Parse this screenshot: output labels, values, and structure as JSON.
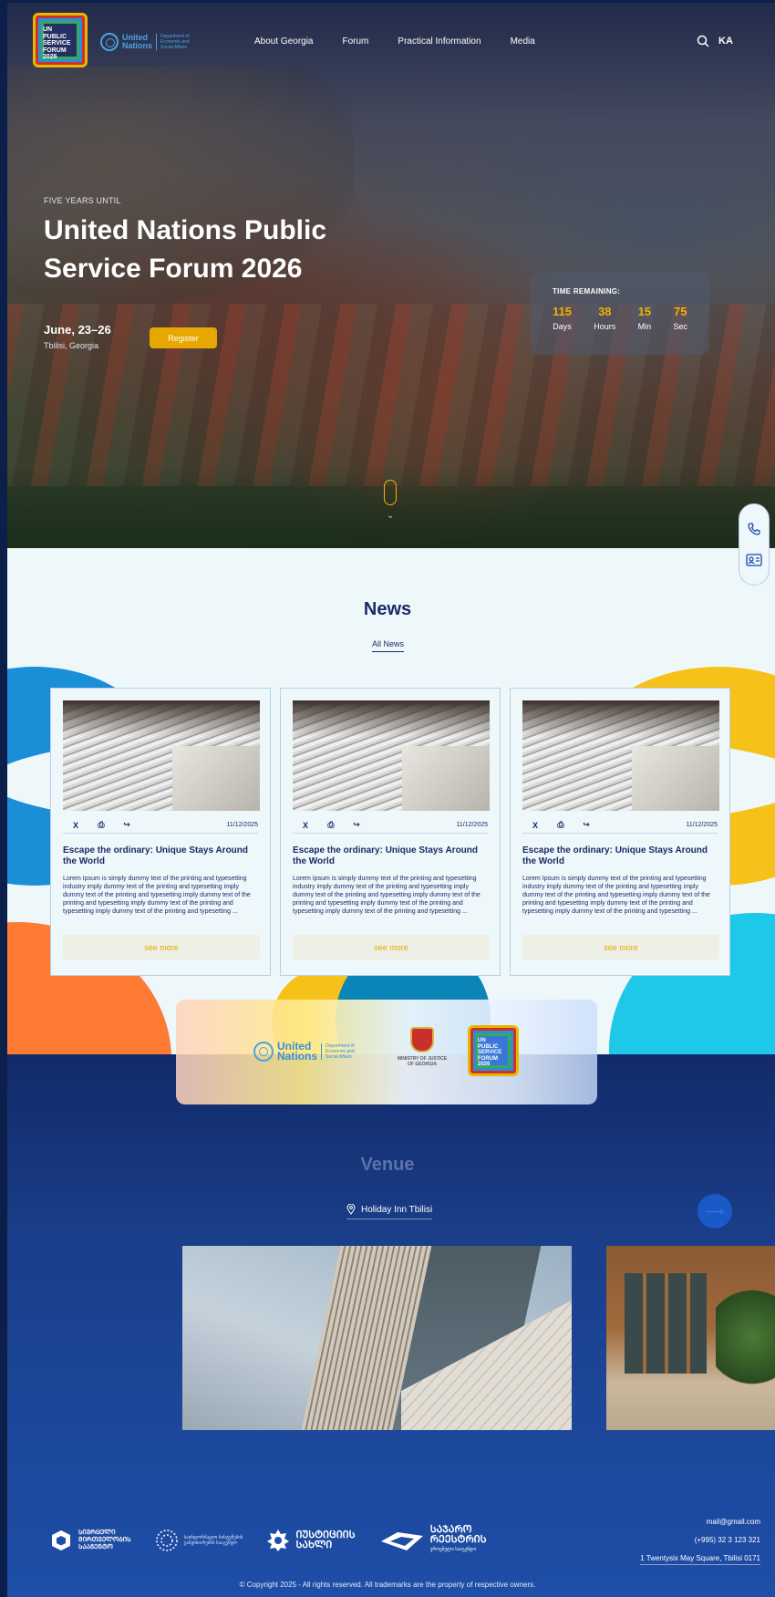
{
  "header": {
    "logo_lines": [
      "UN",
      "PUBLIC",
      "SERVICE",
      "FORUM",
      "2026"
    ],
    "un_name_lines": [
      "United",
      "Nations"
    ],
    "un_dept_lines": [
      "Department of",
      "Economic and",
      "Social Affairs"
    ],
    "nav": [
      "About Georgia",
      "Forum",
      "Practical Information",
      "Media"
    ],
    "lang": "KA"
  },
  "hero": {
    "eyebrow": "FIVE YEARS UNTIL",
    "title": "United Nations Public Service Forum 2026",
    "date": "June, 23–26",
    "city": "Tbilisi, Georgia",
    "register_label": "Register",
    "countdown": {
      "label": "TIME REMAINING:",
      "items": [
        {
          "value": "115",
          "unit": "Days"
        },
        {
          "value": "38",
          "unit": "Hours"
        },
        {
          "value": "15",
          "unit": "Min"
        },
        {
          "value": "75",
          "unit": "Sec"
        }
      ]
    }
  },
  "news": {
    "title": "News",
    "all_link": "All News",
    "cards": [
      {
        "date": "11/12/2025",
        "title": "Escape the ordinary: Unique Stays Around the World",
        "body": "Lorem Ipsum is simply dummy text of the printing and typesetting industry imply dummy text of the printing and typesetting imply dummy text of the printing and typesetting imply dummy text of the printing and typesetting imply dummy text of the printing and typesetting imply dummy text of the printing and typesetting ...",
        "cta": "see more"
      },
      {
        "date": "11/12/2025",
        "title": "Escape the ordinary: Unique Stays Around the World",
        "body": "Lorem Ipsum is simply dummy text of the printing and typesetting industry imply dummy text of the printing and typesetting imply dummy text of the printing and typesetting imply dummy text of the printing and typesetting imply dummy text of the printing and typesetting imply dummy text of the printing and typesetting ...",
        "cta": "see more"
      },
      {
        "date": "11/12/2025",
        "title": "Escape the ordinary: Unique Stays Around the World",
        "body": "Lorem Ipsum is simply dummy text of the printing and typesetting industry imply dummy text of the printing and typesetting imply dummy text of the printing and typesetting imply dummy text of the printing and typesetting imply dummy text of the printing and typesetting imply dummy text of the printing and typesetting ...",
        "cta": "see more"
      }
    ]
  },
  "partners": {
    "un_name_lines": [
      "United",
      "Nations"
    ],
    "un_dept_lines": [
      "Department of",
      "Economic and",
      "Social Affairs"
    ],
    "moj_lines": [
      "MINISTRY OF JUSTICE",
      "OF GEORGIA"
    ],
    "forum_lines": [
      "UN",
      "PUBLIC",
      "SERVICE",
      "FORUM",
      "2026"
    ]
  },
  "venue": {
    "title": "Venue",
    "location": "Holiday Inn Tbilisi"
  },
  "footer": {
    "logos": [
      {
        "lines": [
          "ᲡᲘᲕᲠᲪᲔᲚᲘ",
          "ᲛᲘᲠᲗᲕᲔᲚᲝᲑᲘᲡ",
          "ᲡᲐᲐᲒᲔᲜᲢᲝ"
        ]
      },
      {
        "lines": [
          "საინფორმაციო სისტემების",
          "განვითარების სააგენტო"
        ]
      },
      {
        "lines": [
          "ᲘᲣᲡᲢᲘᲪᲘᲘᲡ",
          "ᲡᲐᲮᲚᲘ"
        ]
      },
      {
        "lines": [
          "ᲡᲐᲯᲐᲠᲝ",
          "ᲠᲔᲔᲡᲢᲠᲘᲡ",
          "ეროვნული სააგენტო"
        ]
      }
    ],
    "email": "mail@gmail.com",
    "phone": "(+995) 32 3 123 321",
    "address": "1 Twentysix May Square, Tbilisi 0171",
    "copyright": "Copyright 2025 - All rights reserved. All trademarks are the property of respective owners."
  },
  "colors": {
    "accent": "#e6a800",
    "navy": "#1a2a66",
    "un_blue": "#4aa3e0"
  }
}
